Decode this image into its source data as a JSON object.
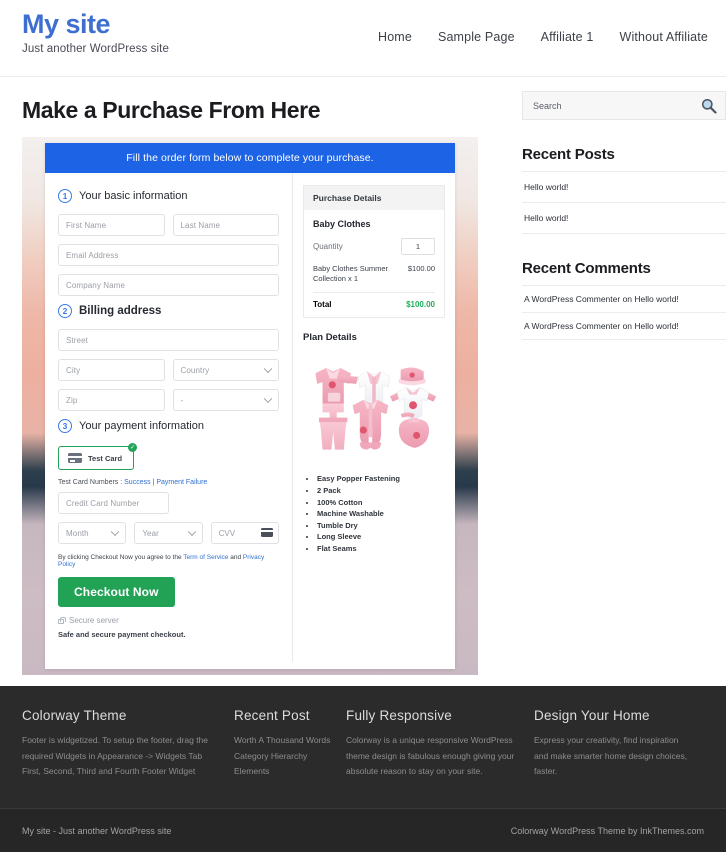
{
  "header": {
    "site_title": "My site",
    "tagline": "Just another WordPress site",
    "nav": [
      {
        "label": "Home"
      },
      {
        "label": "Sample Page"
      },
      {
        "label": "Affiliate 1"
      },
      {
        "label": "Without Affiliate"
      }
    ]
  },
  "main": {
    "page_title": "Make a Purchase From Here",
    "checkout": {
      "banner": "Fill the order form below to complete your purchase.",
      "step1": {
        "num": "1",
        "label": "Your basic information"
      },
      "step2": {
        "num": "2",
        "label": "Billing address"
      },
      "step3": {
        "num": "3",
        "label": "Your payment information"
      },
      "fields": {
        "first_name": "First Name",
        "last_name": "Last Name",
        "email": "Email Address",
        "company": "Company Name",
        "street": "Street",
        "city": "City",
        "country": "Country",
        "zip": "Zip",
        "state": "-",
        "credit_card_number": "Credit Card Number",
        "month": "Month",
        "year": "Year",
        "cvv": "CVV"
      },
      "card_tab": {
        "label": "Test Card",
        "selected_mark": "✓"
      },
      "test_numbers": {
        "prefix": "Test Card Numbers : ",
        "success": "Success",
        "separator": " | ",
        "failure": "Payment Failure"
      },
      "terms": {
        "prefix": "By clicking Checkout Now you agree to the ",
        "tos": "Term of Service",
        "and": " and ",
        "privacy": "Privacy Policy"
      },
      "submit_label": "Checkout Now",
      "secure_server": "Secure server",
      "safe_note": "Safe and secure payment checkout."
    },
    "purchase_details": {
      "heading": "Purchase Details",
      "product": "Baby Clothes",
      "quantity_label": "Quantity",
      "quantity_value": "1",
      "line_item": "Baby Clothes Summer Collection x 1",
      "line_amount": "$100.00",
      "total_label": "Total",
      "total_amount": "$100.00"
    },
    "plan_details": {
      "heading": "Plan Details",
      "image_alt": "baby-clothes-set-image",
      "features": [
        "Easy Popper Fastening",
        "2 Pack",
        "100% Cotton",
        "Machine Washable",
        "Tumble Dry",
        "Long Sleeve",
        "Flat Seams"
      ]
    }
  },
  "sidebar": {
    "search_placeholder": "Search",
    "recent_posts": {
      "title": "Recent Posts",
      "items": [
        "Hello world!",
        "Hello world!"
      ]
    },
    "recent_comments": {
      "title": "Recent Comments",
      "items": [
        "A WordPress Commenter on Hello world!",
        "A WordPress Commenter on Hello world!"
      ]
    }
  },
  "footer": {
    "columns": [
      {
        "title": "Colorway Theme",
        "text": "Footer is widgetized. To setup the footer, drag the required Widgets in Appearance -> Widgets Tab First, Second, Third and Fourth Footer Widget"
      },
      {
        "title": "Recent Post",
        "items": [
          "Worth A Thousand Words",
          "Category Hierarchy",
          "Elements"
        ]
      },
      {
        "title": "Fully Responsive",
        "text": "Colorway is a unique responsive WordPress theme design is fabulous enough giving your absolute reason to stay on your site."
      },
      {
        "title": "Design Your Home",
        "text": "Express your creativity, find inspiration and make smarter home design choices, faster."
      }
    ],
    "bar_left": "My site - Just another WordPress site",
    "bar_right": "Colorway WordPress Theme by InkThemes.com"
  },
  "colors": {
    "brand_blue": "#3e6fd0",
    "banner_blue": "#1d63e6",
    "success_green": "#21a255",
    "total_green": "#1fae5a",
    "footer_bg": "#2b2b2b"
  }
}
